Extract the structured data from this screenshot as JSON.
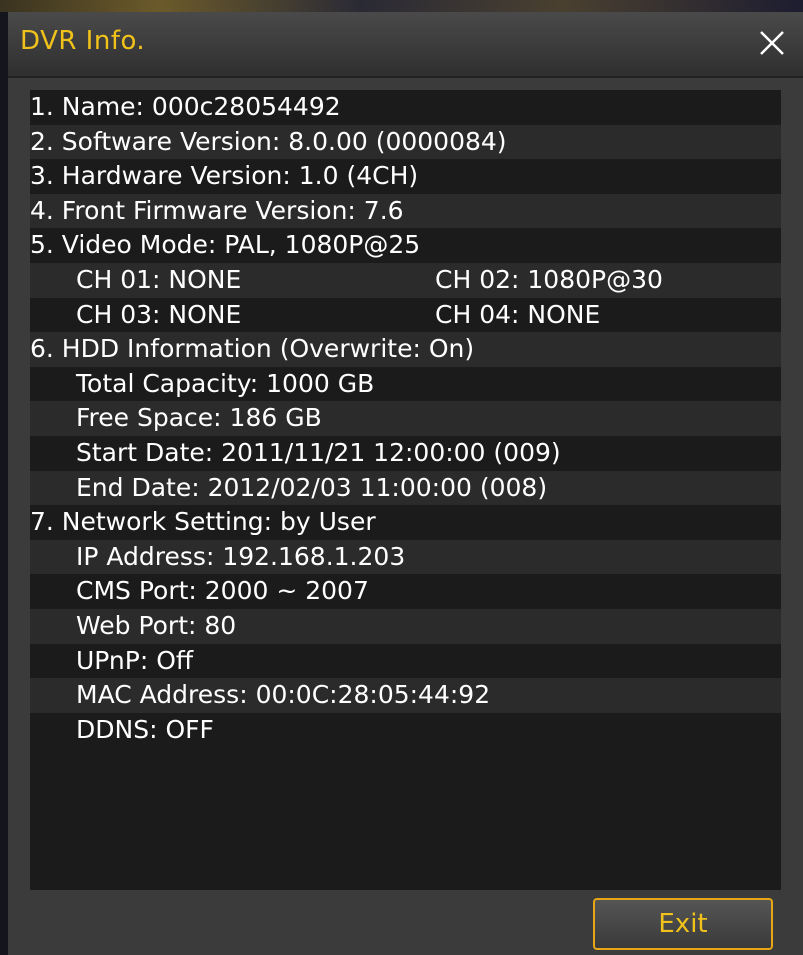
{
  "window": {
    "title": "DVR Info.",
    "close_icon": "close-icon",
    "accent_color": "#f0c21a"
  },
  "info": {
    "name": "1. Name: 000c28054492",
    "software_version": "2. Software Version: 8.0.00 (0000084)",
    "hardware_version": "3. Hardware Version: 1.0 (4CH)",
    "front_firmware": "4. Front Firmware Version: 7.6",
    "video_mode": "5. Video Mode: PAL, 1080P@25",
    "ch01": "CH 01: NONE",
    "ch02": "CH 02: 1080P@30",
    "ch03": "CH 03: NONE",
    "ch04": "CH 04: NONE",
    "hdd_info": "6. HDD Information  (Overwrite: On)",
    "total_capacity": "Total Capacity: 1000 GB",
    "free_space": "Free Space: 186 GB",
    "start_date": "Start Date: 2011/11/21 12:00:00 (009)",
    "end_date": "End Date: 2012/02/03 11:00:00 (008)",
    "network_setting": "7. Network Setting: by User",
    "ip_address": "IP Address: 192.168.1.203",
    "cms_port": "CMS Port: 2000 ~ 2007",
    "web_port": "Web Port: 80",
    "upnp": "UPnP: Off",
    "mac_address": "MAC Address: 00:0C:28:05:44:92",
    "ddns": "DDNS: OFF"
  },
  "buttons": {
    "exit_label": "Exit"
  }
}
